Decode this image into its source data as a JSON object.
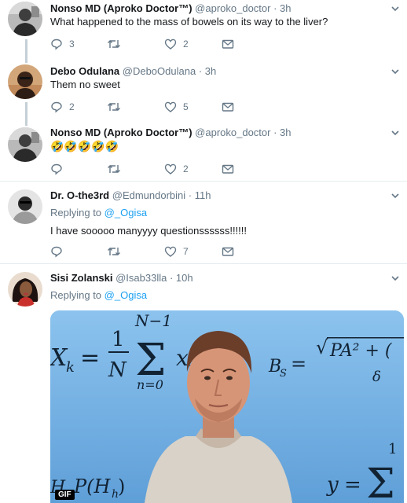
{
  "tweets": [
    {
      "name": "Nonso MD (Aproko Doctor™)",
      "handle": "@aproko_doctor",
      "time": "· 3h",
      "text": "What happened to the mass of bowels on its way to the liver?",
      "replies": "3",
      "retweets": "",
      "likes": "2"
    },
    {
      "name": "Debo Odulana",
      "handle": "@DeboOdulana",
      "time": "· 3h",
      "text": "Them no sweet",
      "replies": "2",
      "retweets": "",
      "likes": "5"
    },
    {
      "name": "Nonso MD (Aproko Doctor™)",
      "handle": "@aproko_doctor",
      "time": "· 3h",
      "text": "🤣🤣🤣🤣🤣",
      "replies": "",
      "retweets": "",
      "likes": "2"
    },
    {
      "name": "Dr. O-the3rd",
      "handle": "@Edmundorbini",
      "time": "· 11h",
      "replying_prefix": "Replying to",
      "replying_to": "@_Ogisa",
      "text": "I have sooooo manyyyy questionssssss!!!!!!",
      "replies": "",
      "retweets": "",
      "likes": "7"
    },
    {
      "name": "Sisi Zolanski",
      "handle": "@Isab33lla",
      "time": "· 10h",
      "replying_prefix": "Replying to",
      "replying_to": "@_Ogisa",
      "media_badge": "GIF"
    }
  ],
  "icons": {
    "reply": "reply-icon",
    "retweet": "retweet-icon",
    "like": "heart-icon",
    "dm": "envelope-icon",
    "more": "chevron-down-icon"
  },
  "colors": {
    "name": "#14171a",
    "secondary": "#657786",
    "link": "#1da1f2",
    "divider": "#e6ecf0",
    "thread": "#c4cfd6"
  }
}
